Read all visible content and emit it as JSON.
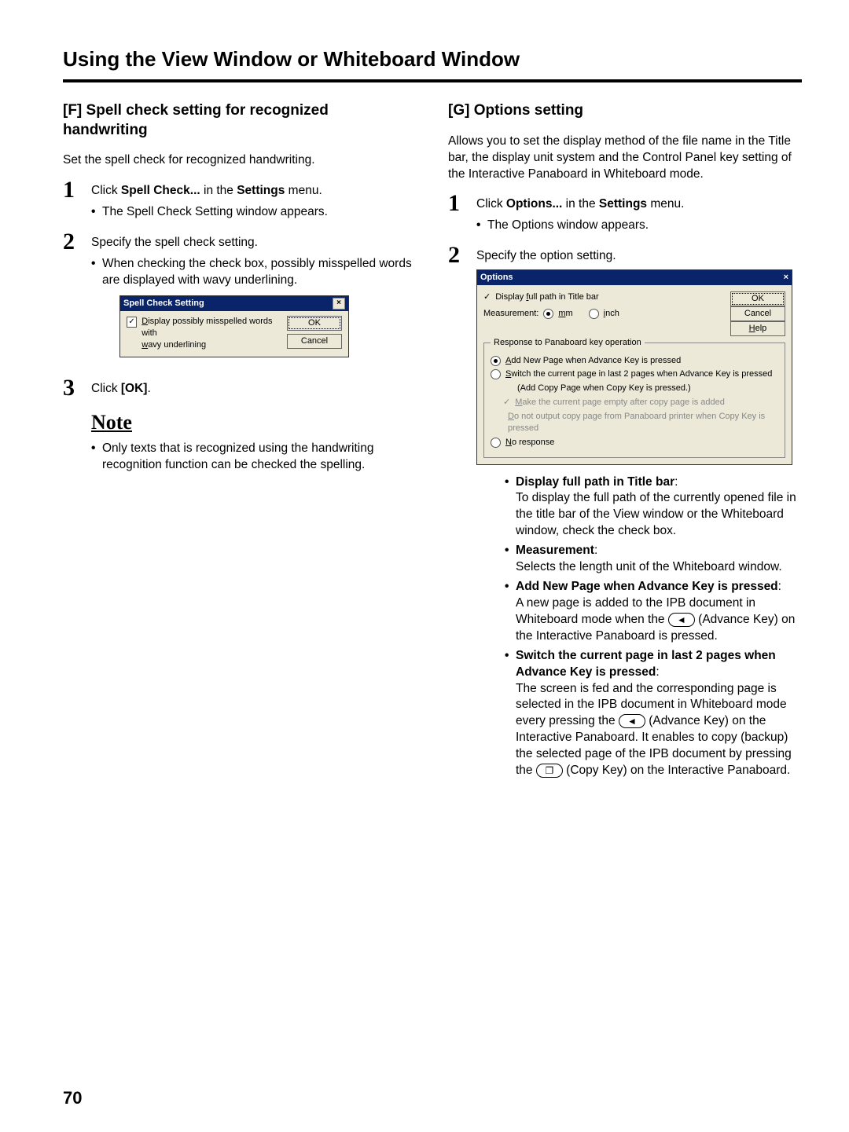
{
  "header": {
    "title": "Using the View Window or Whiteboard Window"
  },
  "page_number": "70",
  "left": {
    "section_title": "[F] Spell check setting for recognized handwriting",
    "intro": "Set the spell check for recognized handwriting.",
    "steps": {
      "s1_line": "Click Spell Check... in the Settings menu.",
      "s1_line_plain_prefix": "Click ",
      "s1_bold1": "Spell Check...",
      "s1_mid": " in the ",
      "s1_bold2": "Settings",
      "s1_suffix": " menu.",
      "s1_sub": "The Spell Check Setting window appears.",
      "s2_line": "Specify the spell check setting.",
      "s2_sub": "When checking the check box, possibly misspelled words are displayed with wavy underlining.",
      "s3_prefix": "Click ",
      "s3_bold": "[OK]",
      "s3_suffix": "."
    },
    "note_heading": "Note",
    "note_body": "Only texts that is recognized using the handwriting recognition function can be checked the spelling.",
    "spell_dialog": {
      "title": "Spell Check Setting",
      "checkbox_label_line1": "Display possibly misspelled words with",
      "checkbox_label_line2": "wavy underlining",
      "underline_char_d": "D",
      "underline_char_w": "w",
      "ok": "OK",
      "cancel": "Cancel",
      "close": "×"
    }
  },
  "right": {
    "section_title": "[G] Options setting",
    "intro": "Allows you to set the display method of the file name in the Title bar, the display unit system and the Control Panel key setting of the Interactive Panaboard in Whiteboard mode.",
    "steps": {
      "s1_prefix": "Click ",
      "s1_bold1": "Options...",
      "s1_mid": " in the ",
      "s1_bold2": "Settings",
      "s1_suffix": " menu.",
      "s1_sub": "The Options window appears.",
      "s2_line": "Specify the option setting."
    },
    "options_dialog": {
      "title": "Options",
      "close": "×",
      "display_full_path_prefix": "Display ",
      "display_full_path_u": "f",
      "display_full_path_suffix": "ull path in Title bar",
      "measurement_label": "Measurement:",
      "mm_u": "m",
      "mm_rest": "m",
      "inch_u": "i",
      "inch_rest": "nch",
      "ok": "OK",
      "cancel": "Cancel",
      "help_u": "H",
      "help_rest": "elp",
      "group_legend": "Response to Panaboard key operation",
      "opt_add_u": "A",
      "opt_add_rest": "dd New Page when Advance Key is pressed",
      "opt_switch_u": "S",
      "opt_switch_rest": "witch the current page in last 2 pages when Advance Key is pressed",
      "opt_switch_paren": "(Add Copy Page when Copy Key is pressed.)",
      "opt_make_empty_u": "M",
      "opt_make_empty_rest": "ake the current page empty after copy page is added",
      "opt_no_output_u": "D",
      "opt_no_output_rest": "o not output copy page from Panaboard printer when Copy Key is pressed",
      "opt_no_response_u": "N",
      "opt_no_response_rest": "o response"
    },
    "defs": {
      "d1_title": "Display full path in Title bar",
      "d1_body": "To display the full path of the currently opened file in the title bar of the View window or the Whiteboard window, check the check box.",
      "d2_title": "Measurement",
      "d2_body": "Selects the length unit of the Whiteboard window.",
      "d3_title": "Add New Page when Advance Key is pressed",
      "d3_body_a": "A new page is added to the IPB document in Whiteboard mode when the ",
      "d3_body_b": " (Advance Key) on the Interactive Panaboard is pressed.",
      "d4_title": "Switch the current page in last 2 pages when Advance Key is pressed",
      "d4_body_a": "The screen is fed and the corresponding page is selected in the IPB document in Whiteboard mode every pressing the ",
      "d4_body_b": " (Advance Key) on the Interactive Panaboard. It enables to copy (backup) the selected page of the IPB document by pressing the ",
      "d4_body_c": " (Copy Key) on the Interactive Panaboard."
    },
    "icons": {
      "advance": "◄",
      "copy": "❐"
    }
  }
}
